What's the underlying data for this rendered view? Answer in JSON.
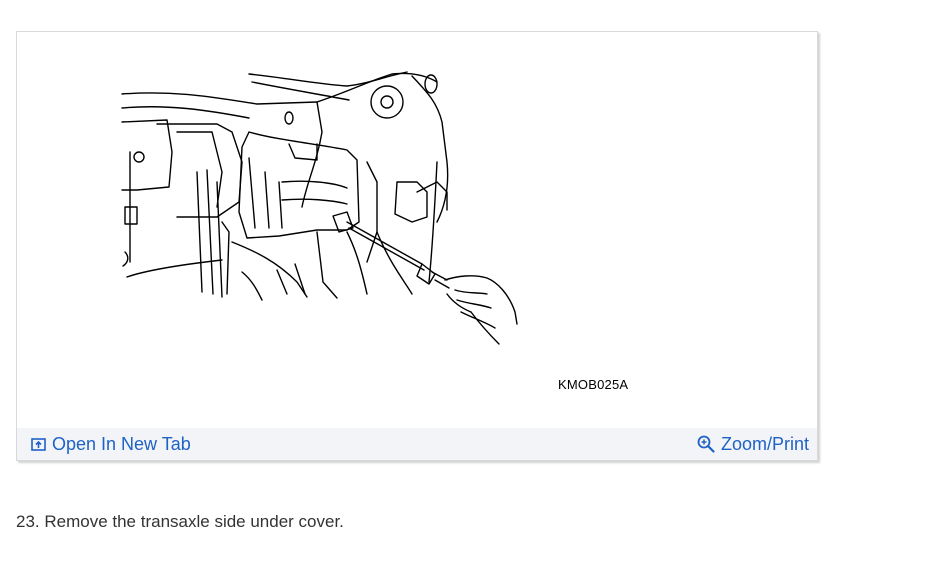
{
  "figure": {
    "image_code": "KMOB025A",
    "actions": {
      "open_new_tab": "Open In New Tab",
      "zoom_print": "Zoom/Print"
    },
    "icons": {
      "open": "open-in-new-tab-icon",
      "zoom": "zoom-icon"
    },
    "link_color": "#1e62c6"
  },
  "step": {
    "text": "23. Remove the transaxle side under cover."
  }
}
